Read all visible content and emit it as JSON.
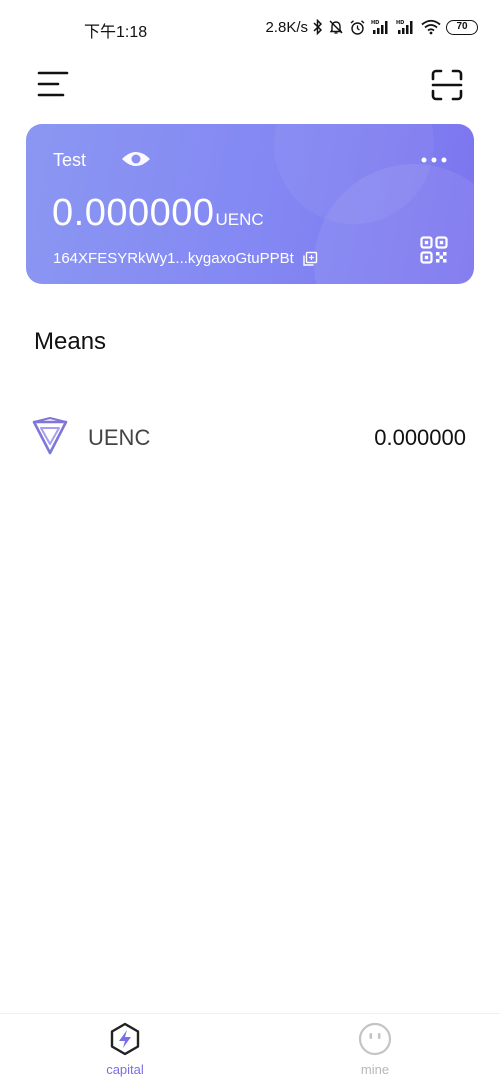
{
  "status_bar": {
    "time": "下午1:18",
    "network_speed": "2.8K/s",
    "battery": "70"
  },
  "header": {
    "menu_icon": "menu-icon",
    "scan_icon": "scan-icon"
  },
  "wallet_card": {
    "name": "Test",
    "balance": "0.000000",
    "unit": "UENC",
    "address": "164XFESYRkWy1...kygaxoGtuPPBt",
    "colors": {
      "gradient_start": "#8b97f2",
      "gradient_end": "#7c75ee"
    }
  },
  "means": {
    "title": "Means",
    "assets": [
      {
        "name": "UENC",
        "amount": "0.000000",
        "icon": "uenc-token-icon"
      }
    ]
  },
  "bottom_nav": {
    "items": [
      {
        "label": "capital",
        "active": true,
        "icon": "lightning-hexagon-icon"
      },
      {
        "label": "mine",
        "active": false,
        "icon": "smiley-face-icon"
      }
    ],
    "active_color": "#7a6ee6",
    "inactive_color": "#b8b8b8"
  }
}
